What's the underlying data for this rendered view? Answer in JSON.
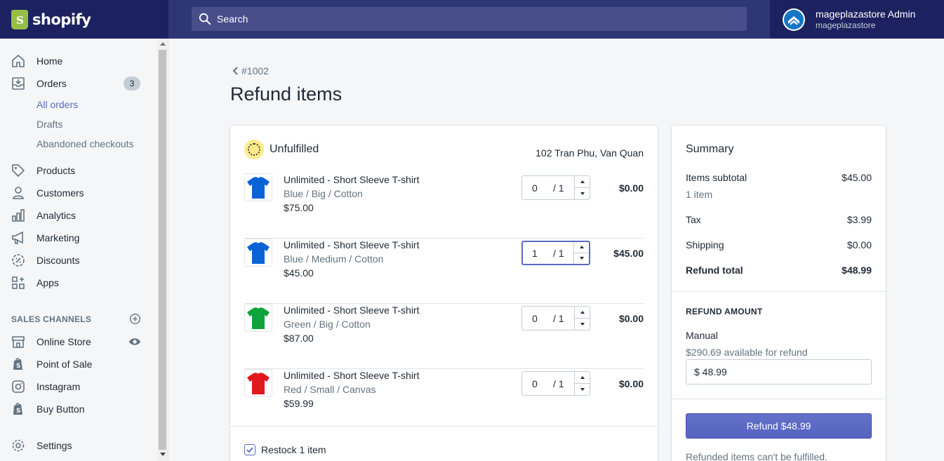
{
  "brand": {
    "name": "shopify"
  },
  "search": {
    "placeholder": "Search"
  },
  "user": {
    "name": "mageplazastore Admin",
    "store": "mageplazastore"
  },
  "sidebar": {
    "items": [
      {
        "label": "Home",
        "icon": "home-icon"
      },
      {
        "label": "Orders",
        "icon": "orders-icon",
        "badge": "3"
      },
      {
        "label": "Products",
        "icon": "tag-icon"
      },
      {
        "label": "Customers",
        "icon": "customer-icon"
      },
      {
        "label": "Analytics",
        "icon": "analytics-icon"
      },
      {
        "label": "Marketing",
        "icon": "megaphone-icon"
      },
      {
        "label": "Discounts",
        "icon": "discount-icon"
      },
      {
        "label": "Apps",
        "icon": "apps-icon"
      }
    ],
    "order_subitems": [
      "All orders",
      "Drafts",
      "Abandoned checkouts"
    ],
    "sales_channels_title": "SALES CHANNELS",
    "channels": [
      {
        "label": "Online Store",
        "icon": "store-icon"
      },
      {
        "label": "Point of Sale",
        "icon": "shopify-bag-icon"
      },
      {
        "label": "Instagram",
        "icon": "instagram-icon"
      },
      {
        "label": "Buy Button",
        "icon": "shopify-bag-icon"
      }
    ],
    "settings_label": "Settings"
  },
  "page": {
    "back_label": "#1002",
    "title": "Refund items"
  },
  "fulfillment": {
    "status": "Unfulfilled",
    "address": "102 Tran Phu, Van Quan"
  },
  "line_items": [
    {
      "name": "Unlimited - Short Sleeve T-shirt",
      "variant": "Blue / Big / Cotton",
      "price": "$75.00",
      "qty": "0",
      "max": "/ 1",
      "total": "$0.00",
      "shirt_color": "#0b62d6"
    },
    {
      "name": "Unlimited - Short Sleeve T-shirt",
      "variant": "Blue / Medium / Cotton",
      "price": "$45.00",
      "qty": "1",
      "max": "/ 1",
      "total": "$45.00",
      "shirt_color": "#0b62d6"
    },
    {
      "name": "Unlimited - Short Sleeve T-shirt",
      "variant": "Green / Big / Cotton",
      "price": "$87.00",
      "qty": "0",
      "max": "/ 1",
      "total": "$0.00",
      "shirt_color": "#0fa33b"
    },
    {
      "name": "Unlimited - Short Sleeve T-shirt",
      "variant": "Red / Small / Canvas",
      "price": "$59.99",
      "qty": "0",
      "max": "/ 1",
      "total": "$0.00",
      "shirt_color": "#e0191f"
    }
  ],
  "restock": {
    "label": "Restock 1 item",
    "checked": true
  },
  "summary": {
    "title": "Summary",
    "items_subtotal_label": "Items subtotal",
    "items_subtotal": "$45.00",
    "items_count": "1 item",
    "tax_label": "Tax",
    "tax": "$3.99",
    "shipping_label": "Shipping",
    "shipping": "$0.00",
    "refund_total_label": "Refund total",
    "refund_total": "$48.99",
    "refund_amount_heading": "REFUND AMOUNT",
    "manual_label": "Manual",
    "available": "$290.69 available for refund",
    "amount_value": "$ 48.99",
    "refund_button": "Refund $48.99",
    "note": "Refunded items can't be fulfilled."
  },
  "colors": {
    "topbar": "#1c2260",
    "accent": "#5c6ac4",
    "shirt_blue": "#0b62d6",
    "shirt_green": "#0fa33b",
    "shirt_red": "#e0191f"
  }
}
